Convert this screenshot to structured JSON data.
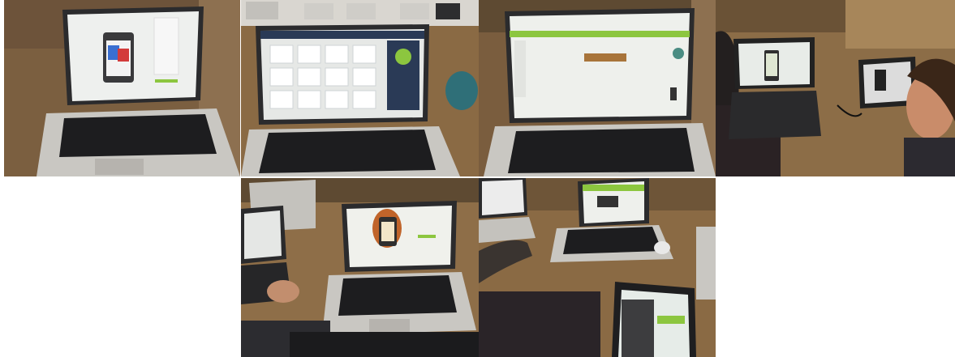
{
  "collage": {
    "photos": [
      {
        "subject": "laptop-screen-app-editor"
      },
      {
        "subject": "laptop-screen-grid-of-screens"
      },
      {
        "subject": "laptop-screen-green-web-editor"
      },
      {
        "subject": "students-at-laptops"
      },
      {
        "subject": "laptop-phone-mockup-on-desk"
      },
      {
        "subject": "tablet-and-laptop-on-desk"
      }
    ]
  },
  "colors": {
    "wood": "#8a6a44",
    "wood_dark": "#5e4a32",
    "laptop_silver": "#c9c7c2",
    "keyboard_black": "#1d1d1f",
    "screen_white": "#e9ecea",
    "accent_green": "#8cc63f",
    "blue_block": "#3a6fd1",
    "red_block": "#d33b3b"
  }
}
